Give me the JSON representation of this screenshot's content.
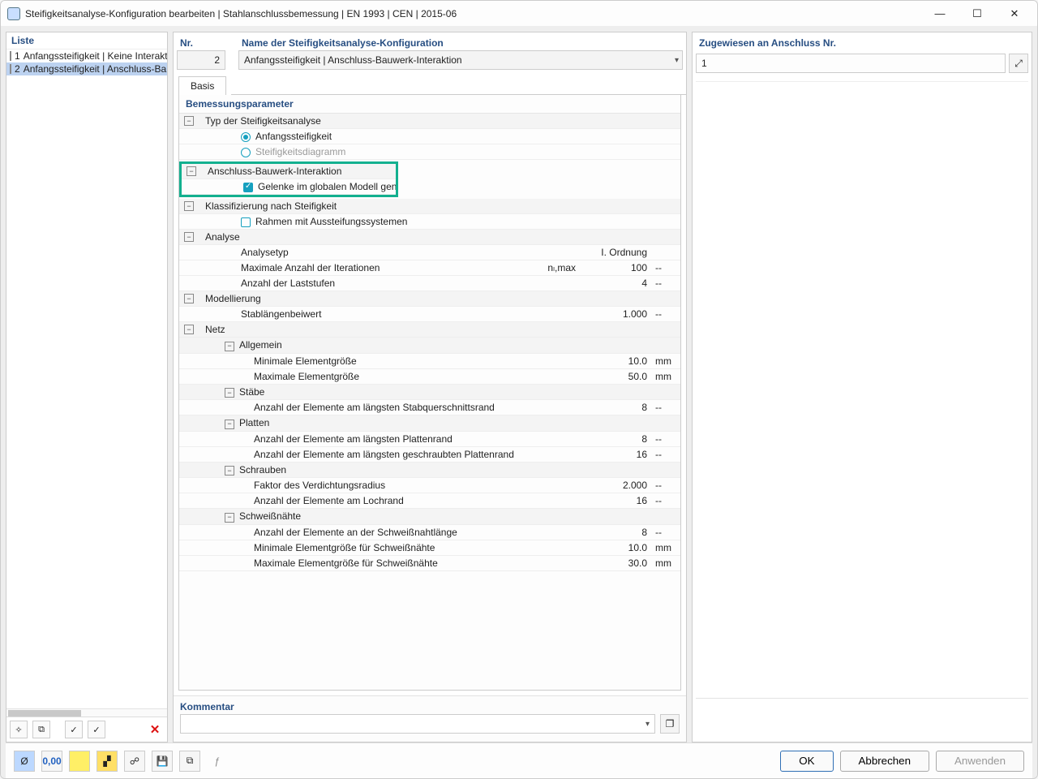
{
  "window": {
    "title": "Steifigkeitsanalyse-Konfiguration bearbeiten | Stahlanschlussbemessung | EN 1993 | CEN | 2015-06"
  },
  "left": {
    "header": "Liste",
    "items": [
      {
        "idx": "1",
        "label": "Anfangssteifigkeit | Keine Interaktion",
        "selected": false,
        "color": "#bfe7ef"
      },
      {
        "idx": "2",
        "label": "Anfangssteifigkeit | Anschluss-Bauwerk-Interaktion",
        "selected": true,
        "color": "#c8c16a"
      }
    ]
  },
  "header": {
    "nr_label": "Nr.",
    "nr_value": "2",
    "name_label": "Name der Steifigkeitsanalyse-Konfiguration",
    "name_value": "Anfangssteifigkeit | Anschluss-Bauwerk-Interaktion",
    "assigned_label": "Zugewiesen an Anschluss Nr.",
    "assigned_value": "1"
  },
  "tab": {
    "basis": "Basis"
  },
  "params": {
    "title": "Bemessungsparameter",
    "stiff_type": "Typ der Steifigkeitsanalyse",
    "opt_initial": "Anfangssteifigkeit",
    "opt_diagram": "Steifigkeitsdiagramm",
    "interaction": "Anschluss-Bauwerk-Interaktion",
    "gen_hinges": "Gelenke im globalen Modell generieren",
    "classification": "Klassifizierung nach Steifigkeit",
    "braced_frames": "Rahmen mit Aussteifungssystemen",
    "analysis": "Analyse",
    "analysis_type": "Analysetyp",
    "analysis_type_val": "I. Ordnung",
    "max_iter": "Maximale Anzahl der Iterationen",
    "max_iter_sym": "nₗ,max",
    "max_iter_val": "100",
    "load_steps": "Anzahl der Laststufen",
    "load_steps_val": "4",
    "modelling": "Modellierung",
    "len_factor": "Stablängenbeiwert",
    "len_factor_val": "1.000",
    "mesh": "Netz",
    "general": "Allgemein",
    "min_elem": "Minimale Elementgröße",
    "min_elem_val": "10.0",
    "max_elem": "Maximale Elementgröße",
    "max_elem_val": "50.0",
    "members": "Stäbe",
    "members_elem": "Anzahl der Elemente am längsten Stabquerschnittsrand",
    "members_elem_val": "8",
    "plates": "Platten",
    "plates_elem": "Anzahl der Elemente am längsten Plattenrand",
    "plates_elem_val": "8",
    "plates_bolt": "Anzahl der Elemente am längsten geschraubten Plattenrand",
    "plates_bolt_val": "16",
    "bolts": "Schrauben",
    "bolts_radius": "Faktor des Verdichtungsradius",
    "bolts_radius_val": "2.000",
    "bolts_hole": "Anzahl der Elemente am Lochrand",
    "bolts_hole_val": "16",
    "welds": "Schweißnähte",
    "welds_len": "Anzahl der Elemente an der Schweißnahtlänge",
    "welds_len_val": "8",
    "welds_min": "Minimale Elementgröße für Schweißnähte",
    "welds_min_val": "10.0",
    "welds_max": "Maximale Elementgröße für Schweißnähte",
    "welds_max_val": "30.0",
    "unit_mm": "mm",
    "unit_dash": "--"
  },
  "comment": {
    "label": "Kommentar"
  },
  "buttons": {
    "ok": "OK",
    "cancel": "Abbrechen",
    "apply": "Anwenden"
  }
}
